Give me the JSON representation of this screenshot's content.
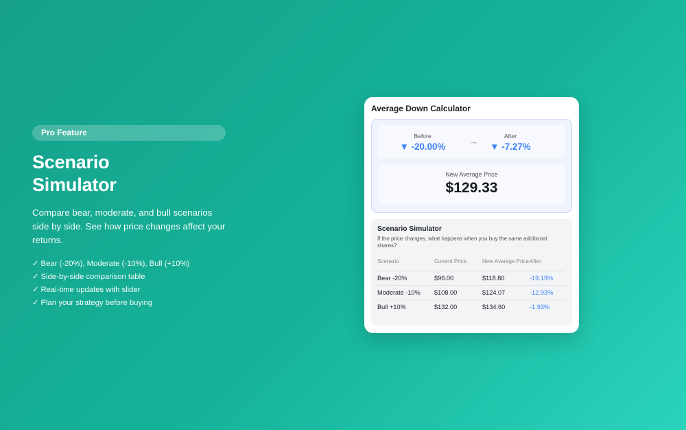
{
  "promo": {
    "badge": "Pro Feature",
    "title_line1": "Scenario",
    "title_line2": "Simulator",
    "description": "Compare bear, moderate, and bull scenarios side by side. See how price changes affect your returns.",
    "features": [
      "Bear (-20%), Moderate (-10%), Bull (+10%)",
      "Side-by-side comparison table",
      "Real-time updates with slider",
      "Plan your strategy before buying"
    ]
  },
  "calculator": {
    "title": "Average Down Calculator",
    "before_label": "Before",
    "before_value": "▼ -20.00%",
    "after_label": "After",
    "after_value": "▼ -7.27%",
    "new_avg_label": "New Average Price",
    "new_avg_value": "$129.33"
  },
  "simulator": {
    "title": "Scenario Simulator",
    "description": "If the price changes, what happens when you buy the same additional shares?",
    "headers": [
      "Scenario",
      "Current Price",
      "New Average Price",
      "After"
    ],
    "rows": [
      {
        "scenario": "Bear -20%",
        "current": "$96.00",
        "new_avg": "$118.80",
        "after": "-19.19%"
      },
      {
        "scenario": "Moderate -10%",
        "current": "$108.00",
        "new_avg": "$124.07",
        "after": "-12.93%"
      },
      {
        "scenario": "Bull +10%",
        "current": "$132.00",
        "new_avg": "$134.60",
        "after": "-1.93%"
      }
    ]
  },
  "colors": {
    "accent_blue": "#3b82f6",
    "background_start": "#16a08a",
    "background_end": "#2bd3bb"
  },
  "icons": {
    "feature_check": "check-icon",
    "before_after_arrow": "arrow-right-icon"
  }
}
